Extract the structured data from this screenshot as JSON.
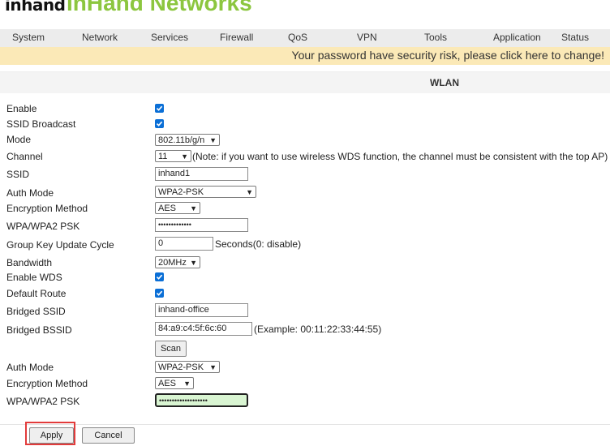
{
  "logo": {
    "mark": "inhand",
    "text": "InHand Networks"
  },
  "menu": [
    "System",
    "Network",
    "Services",
    "Firewall",
    "QoS",
    "VPN",
    "Tools",
    "Application",
    "Status"
  ],
  "notice": "Your password have security risk, please click here to change!",
  "section_title": "WLAN",
  "labels": {
    "enable": "Enable",
    "ssid_broadcast": "SSID Broadcast",
    "mode": "Mode",
    "channel": "Channel",
    "ssid": "SSID",
    "auth_mode": "Auth Mode",
    "encryption_method": "Encryption Method",
    "wpa_psk": "WPA/WPA2 PSK",
    "group_key": "Group Key Update Cycle",
    "bandwidth": "Bandwidth",
    "enable_wds": "Enable WDS",
    "default_route": "Default Route",
    "bridged_ssid": "Bridged SSID",
    "bridged_bssid": "Bridged BSSID",
    "wds_auth_mode": "Auth Mode",
    "wds_encryption_method": "Encryption Method",
    "wds_wpa_psk": "WPA/WPA2 PSK"
  },
  "values": {
    "mode": "802.11b/g/n",
    "channel": "11",
    "channel_note": "(Note: if you want to use wireless WDS function, the channel must be consistent with the top AP)",
    "ssid": "inhand1",
    "auth_mode": "WPA2-PSK",
    "encryption_method": "AES",
    "wpa_psk": "•••••••••••••",
    "group_key": "0",
    "group_key_note": "Seconds(0: disable)",
    "bandwidth": "20MHz",
    "bridged_ssid": "inhand-office",
    "bridged_bssid": "84:a9:c4:5f:6c:60",
    "bridged_bssid_note": "(Example: 00:11:22:33:44:55)",
    "wds_auth_mode": "WPA2-PSK",
    "wds_encryption_method": "AES",
    "wds_wpa_psk": "•••••••••••••••••••"
  },
  "buttons": {
    "scan": "Scan",
    "apply": "Apply",
    "cancel": "Cancel"
  },
  "colors": {
    "accent": "#8cc63f",
    "checkbox": "#0b6fd6",
    "notice_bg": "#fbe9b7",
    "highlight": "#e23b3b",
    "focus_bg": "#d9f5d2"
  }
}
